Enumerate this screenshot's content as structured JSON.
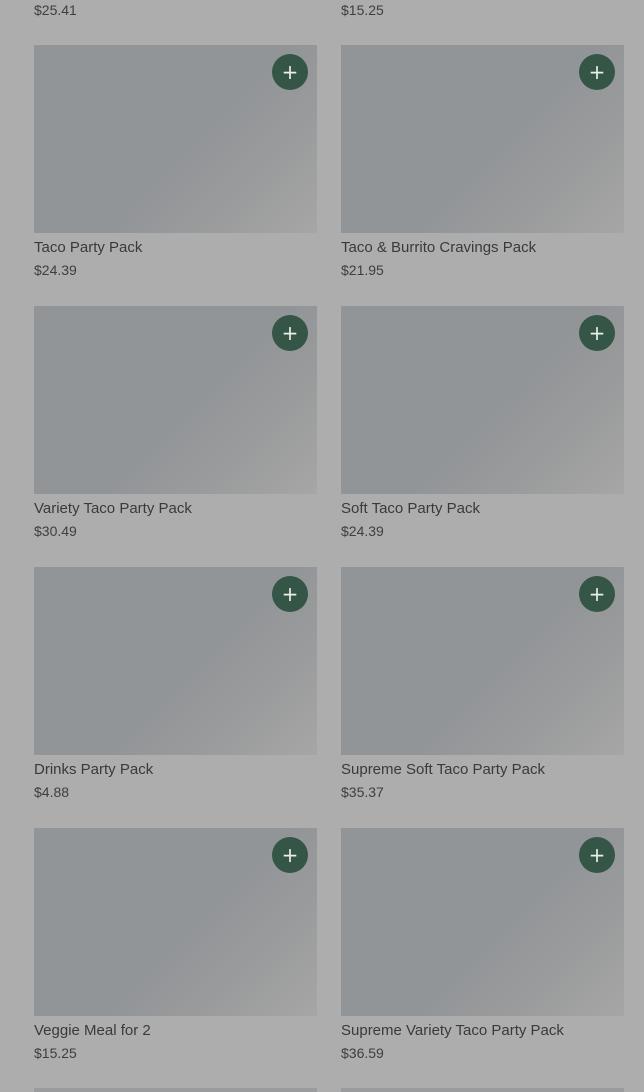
{
  "top_row": {
    "left_price": "$25.41",
    "right_price": "$15.25"
  },
  "add_icon": "plus-icon",
  "add_glyph": "+",
  "products": [
    {
      "name": "Taco Party Pack",
      "price": "$24.39"
    },
    {
      "name": "Taco & Burrito Cravings Pack",
      "price": "$21.95"
    },
    {
      "name": "Variety Taco Party Pack",
      "price": "$30.49"
    },
    {
      "name": "Soft Taco Party Pack",
      "price": "$24.39"
    },
    {
      "name": "Drinks Party Pack",
      "price": "$4.88"
    },
    {
      "name": "Supreme Soft Taco Party Pack",
      "price": "$35.37"
    },
    {
      "name": "Veggie Meal for 2",
      "price": "$15.25"
    },
    {
      "name": "Supreme Variety Taco Party Pack",
      "price": "$36.59"
    }
  ],
  "colors": {
    "overlay_background": "#adadad",
    "add_button": "#355546",
    "image_placeholder": "#929598"
  }
}
